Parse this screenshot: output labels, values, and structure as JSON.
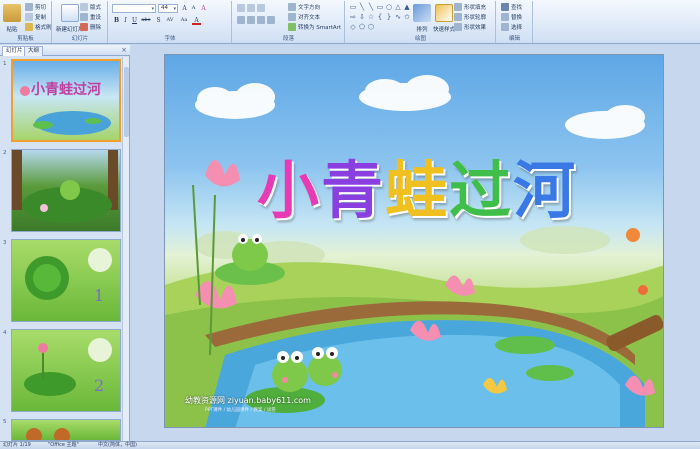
{
  "ribbon": {
    "clipboard": {
      "paste": "粘贴",
      "cut": "剪切",
      "copy": "复制",
      "format_painter": "格式刷",
      "label": "剪贴板"
    },
    "slides": {
      "new_slide": "新建幻灯片",
      "layout": "版式",
      "reset": "重设",
      "delete": "删除",
      "label": "幻灯片"
    },
    "font": {
      "font_name": "",
      "font_size": "44",
      "grow": "A",
      "shrink": "A",
      "clear": "A",
      "bold": "B",
      "italic": "I",
      "underline": "U",
      "strike": "abe",
      "shadow": "S",
      "spacing": "AV",
      "case": "Aa",
      "color": "A",
      "label": "字体"
    },
    "paragraph": {
      "text_direction": "文字方向",
      "align_text": "对齐文本",
      "smartart": "转换为 SmartArt",
      "label": "段落"
    },
    "drawing": {
      "arrange": "排列",
      "quick_styles": "快速样式",
      "shape_fill": "形状填充",
      "shape_outline": "形状轮廓",
      "shape_effects": "形状效果",
      "label": "绘图"
    },
    "editing": {
      "find": "查找",
      "replace": "替换",
      "select": "选择",
      "label": "编辑"
    }
  },
  "panel": {
    "tabs": [
      "幻灯片",
      "大纲"
    ],
    "close": "×",
    "thumbs": [
      {
        "num": "1",
        "title": "小青蛙过河"
      },
      {
        "num": "2",
        "title": ""
      },
      {
        "num": "3",
        "title": "1"
      },
      {
        "num": "4",
        "title": "2"
      },
      {
        "num": "5",
        "title": ""
      }
    ]
  },
  "slide": {
    "title_chars": [
      "小",
      "青",
      "蛙",
      "过",
      "河"
    ],
    "title_colors": [
      "#e83ab5",
      "#8a3fe0",
      "#f0c020",
      "#3fbf4a",
      "#3a78e6"
    ],
    "watermark": "幼教资源网 ziyuan.baby611.com",
    "watermark_sub": "PPT课件 / 幼儿园课件 / 教案 / 试卷"
  },
  "status": {
    "slide_info": "幻灯片 1/19",
    "theme": "\"Office 主题\"",
    "language": "中文(简体，中国)"
  }
}
